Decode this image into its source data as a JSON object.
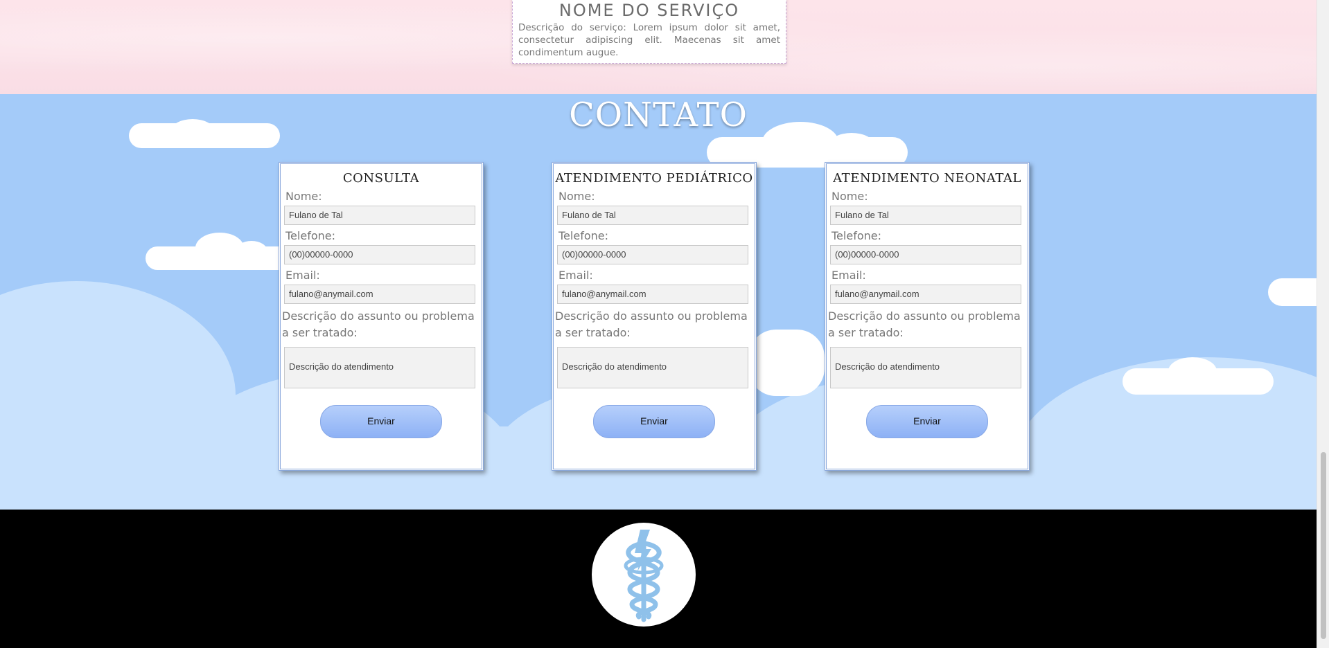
{
  "service": {
    "title": "NOME DO SERVIÇO",
    "description": "Descrição do serviço: Lorem ipsum dolor sit amet, consectetur adipiscing elit. Maecenas sit amet condimentum augue."
  },
  "contact": {
    "title": "CONTATO",
    "forms": [
      {
        "heading": "CONSULTA",
        "name_label": "Nome:",
        "name_placeholder": "Fulano de Tal",
        "phone_label": "Telefone:",
        "phone_placeholder": "(00)00000-0000",
        "email_label": "Email:",
        "email_placeholder": "fulano@anymail.com",
        "desc_label": "Descrição do assunto ou problema a ser tratado:",
        "desc_placeholder": "Descrição do atendimento",
        "submit_label": "Enviar"
      },
      {
        "heading": "ATENDIMENTO PEDIÁTRICO",
        "name_label": "Nome:",
        "name_placeholder": "Fulano de Tal",
        "phone_label": "Telefone:",
        "phone_placeholder": "(00)00000-0000",
        "email_label": "Email:",
        "email_placeholder": "fulano@anymail.com",
        "desc_label": "Descrição do assunto ou problema a ser tratado:",
        "desc_placeholder": "Descrição do atendimento",
        "submit_label": "Enviar"
      },
      {
        "heading": "ATENDIMENTO NEONATAL",
        "name_label": "Nome:",
        "name_placeholder": "Fulano de Tal",
        "phone_label": "Telefone:",
        "phone_placeholder": "(00)00000-0000",
        "email_label": "Email:",
        "email_placeholder": "fulano@anymail.com",
        "desc_label": "Descrição do assunto ou problema a ser tratado:",
        "desc_placeholder": "Descrição do atendimento",
        "submit_label": "Enviar"
      }
    ]
  },
  "footer": {
    "logo_icon": "caduceus-icon"
  },
  "colors": {
    "sky": "#a4cbf9",
    "button": "#a4c2f8",
    "logo": "#8fc1ea"
  }
}
